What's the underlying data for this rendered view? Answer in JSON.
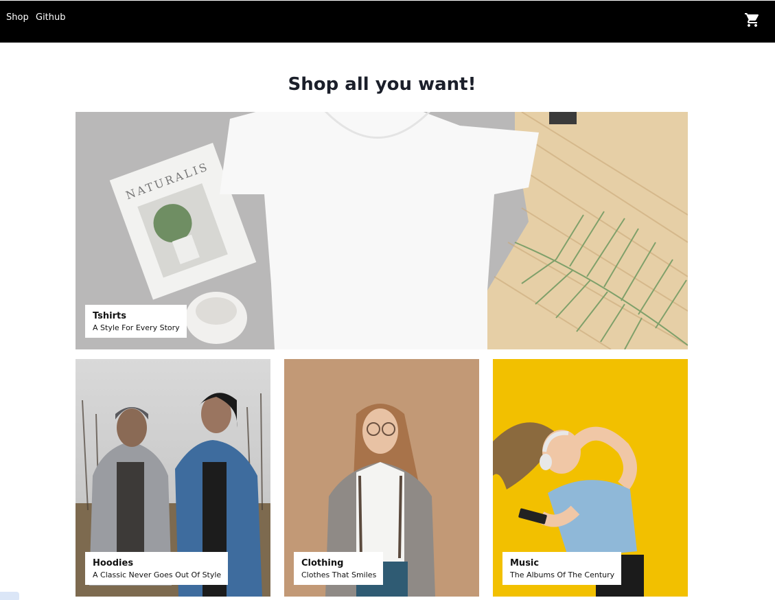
{
  "nav": {
    "links": [
      "Shop",
      "Github"
    ],
    "cart_icon": "cart-icon"
  },
  "page": {
    "title": "Shop all you want!"
  },
  "categories": [
    {
      "title": "Tshirts",
      "subtitle": "A Style For Every Story"
    },
    {
      "title": "Hoodies",
      "subtitle": "A Classic Never Goes Out Of Style"
    },
    {
      "title": "Clothing",
      "subtitle": "Clothes That Smiles"
    },
    {
      "title": "Music",
      "subtitle": "The Albums Of The Century"
    }
  ],
  "colors": {
    "navbar": "#000000",
    "heading": "#1b1f2a",
    "music_bg": "#f2c000"
  }
}
